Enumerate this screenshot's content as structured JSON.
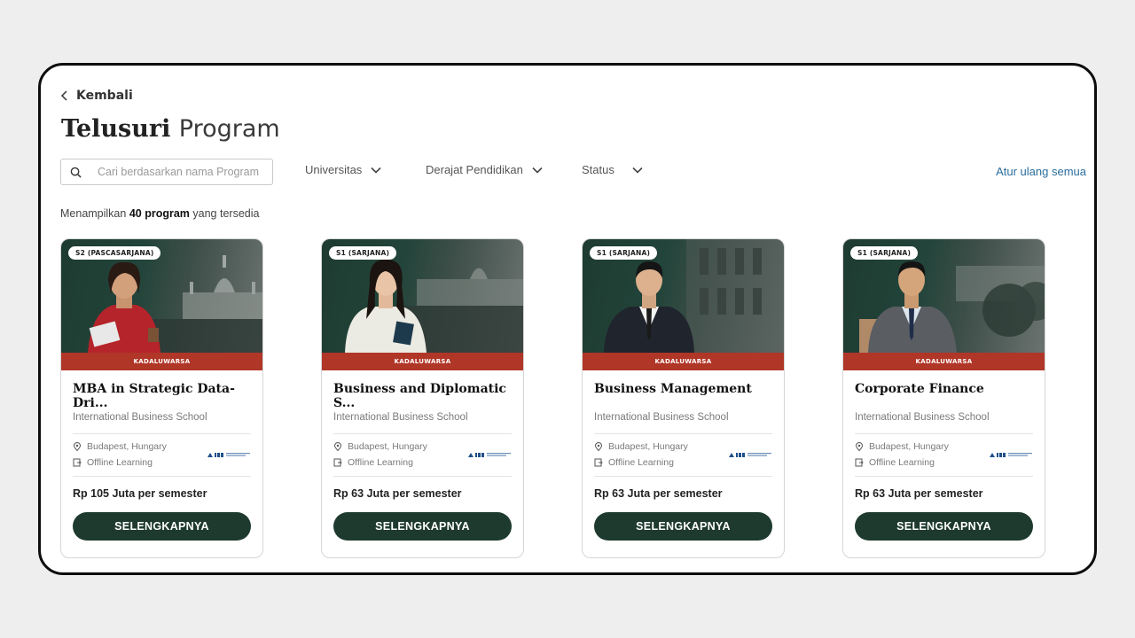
{
  "header": {
    "back_label": "Kembali",
    "title_strong": "Telusuri",
    "title_light": "Program"
  },
  "filters": {
    "search_placeholder": "Cari berdasarkan nama Program",
    "search_value": "",
    "university": "Universitas",
    "degree": "Derajat Pendidikan",
    "status": "Status",
    "reset": "Atur ulang semua"
  },
  "results": {
    "prefix": "Menampilkan",
    "count": "40 program",
    "suffix": "yang tersedia"
  },
  "cards": [
    {
      "degree": "S2 (PASCASARJANA)",
      "status": "KADALUWARSA",
      "name": "MBA in Strategic Data-Dri...",
      "university": "International Business School",
      "location": "Budapest, Hungary",
      "mode": "Offline Learning",
      "price": "Rp 105 Juta per semester",
      "button": "SELENGKAPNYA"
    },
    {
      "degree": "S1 (SARJANA)",
      "status": "KADALUWARSA",
      "name": "Business and Diplomatic S...",
      "university": "International Business School",
      "location": "Budapest, Hungary",
      "mode": "Offline Learning",
      "price": "Rp 63 Juta per semester",
      "button": "SELENGKAPNYA"
    },
    {
      "degree": "S1 (SARJANA)",
      "status": "KADALUWARSA",
      "name": "Business Management",
      "university": "International Business School",
      "location": "Budapest, Hungary",
      "mode": "Offline Learning",
      "price": "Rp 63 Juta per semester",
      "button": "SELENGKAPNYA"
    },
    {
      "degree": "S1 (SARJANA)",
      "status": "KADALUWARSA",
      "name": "Corporate Finance",
      "university": "International Business School",
      "location": "Budapest, Hungary",
      "mode": "Offline Learning",
      "price": "Rp 63 Juta per semester",
      "button": "SELENGKAPNYA"
    }
  ],
  "colors": {
    "primary_dark_green": "#1e3a2f",
    "expired_red": "#b03628",
    "link_blue": "#2a6d9e"
  }
}
